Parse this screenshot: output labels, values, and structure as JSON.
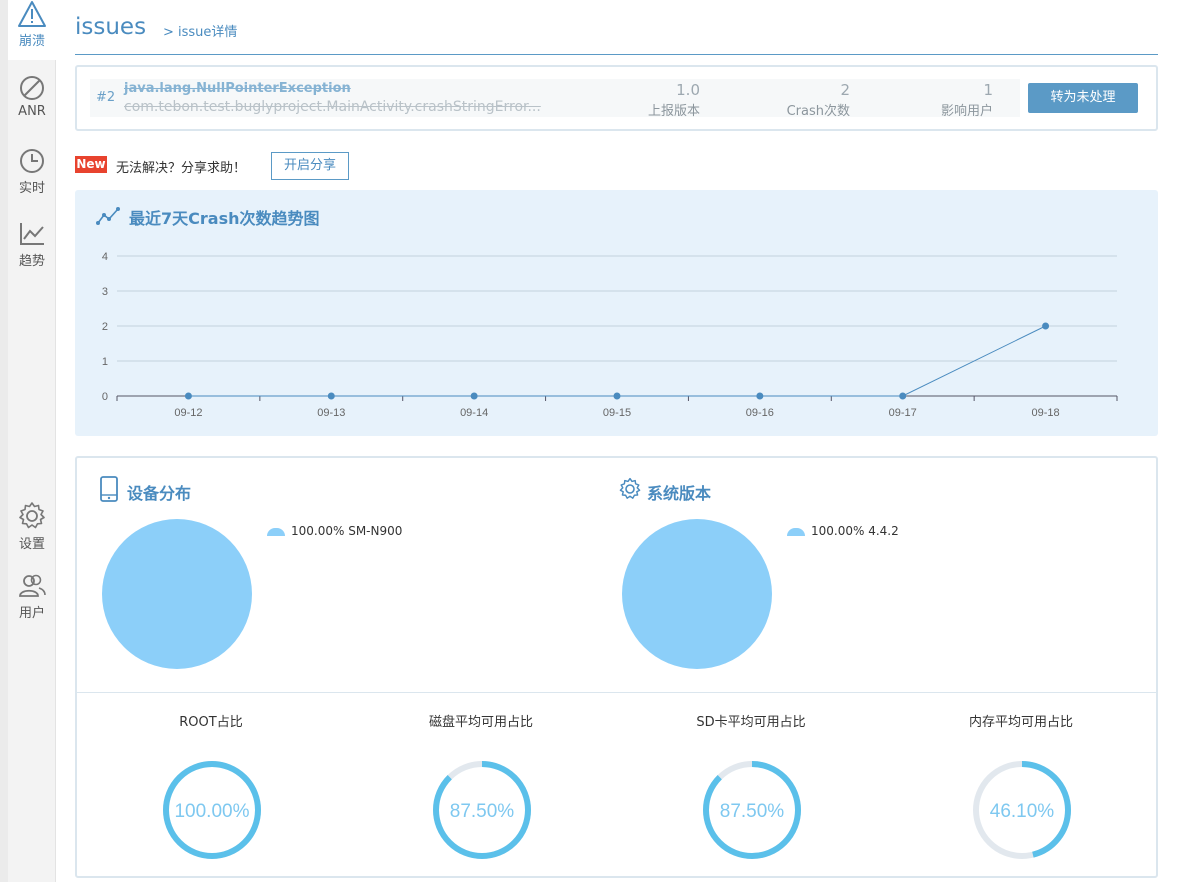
{
  "sidebar": {
    "items": [
      {
        "label": "崩溃",
        "icon": "warning-icon",
        "active": true
      },
      {
        "label": "ANR",
        "icon": "no-entry-icon"
      },
      {
        "label": "实时",
        "icon": "clock-icon"
      },
      {
        "label": "趋势",
        "icon": "trend-chart-icon"
      },
      {
        "label": "设置",
        "icon": "gear-icon"
      },
      {
        "label": "用户",
        "icon": "users-icon"
      }
    ]
  },
  "header": {
    "title": "issues",
    "breadcrumb": "> issue详情"
  },
  "issue": {
    "number": "#2",
    "exception": "java.lang.NullPointerException",
    "location": "com.tebon.test.buglyproject.MainActivity.crashStringError...",
    "stats": [
      {
        "value": "1.0",
        "label": "上报版本"
      },
      {
        "value": "2",
        "label": "Crash次数"
      },
      {
        "value": "1",
        "label": "影响用户"
      }
    ],
    "action_label": "转为未处理"
  },
  "share": {
    "badge": "New",
    "text": "无法解决？分享求助！",
    "button_label": "开启分享"
  },
  "trend": {
    "title": "最近7天Crash次数趋势图",
    "icon": "line-chart-icon"
  },
  "chart_data": {
    "type": "line",
    "title": "最近7天Crash次数趋势图",
    "categories": [
      "09-12",
      "09-13",
      "09-14",
      "09-15",
      "09-16",
      "09-17",
      "09-18"
    ],
    "series": [
      {
        "values": [
          0,
          0,
          0,
          0,
          0,
          0,
          2
        ],
        "color": "#4a8bbf"
      }
    ],
    "yticks": [
      0,
      1,
      2,
      3,
      4
    ],
    "ylim": [
      0,
      4
    ],
    "grid": true,
    "legend": "none"
  },
  "distribution": {
    "device": {
      "title": "设备分布",
      "icon": "phone-icon",
      "legend": "100.00% SM-N900",
      "share": 1.0
    },
    "os": {
      "title": "系统版本",
      "icon": "gear-icon",
      "legend": "100.00% 4.4.2",
      "share": 1.0
    },
    "gauges": [
      {
        "label": "ROOT占比",
        "value_text": "100.00%",
        "fraction": 1.0
      },
      {
        "label": "磁盘平均可用占比",
        "value_text": "87.50%",
        "fraction": 0.875
      },
      {
        "label": "SD卡平均可用占比",
        "value_text": "87.50%",
        "fraction": 0.875
      },
      {
        "label": "内存平均可用占比",
        "value_text": "46.10%",
        "fraction": 0.461
      }
    ]
  },
  "colors": {
    "accent": "#4a8bbf",
    "pie": "#8ccff9",
    "gauge_fill": "#5bc0ea",
    "gauge_track": "#e2e8ee",
    "badge": "#e8432e"
  }
}
